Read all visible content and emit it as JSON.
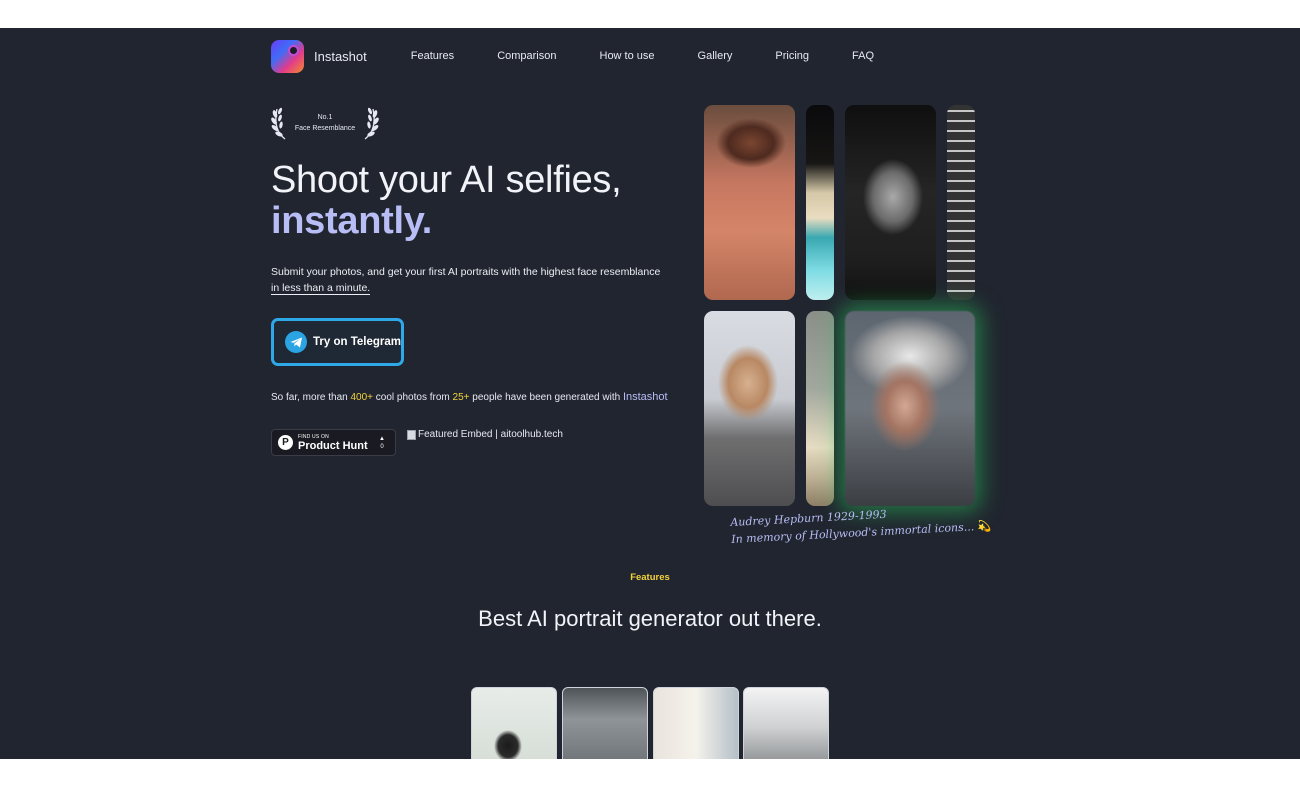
{
  "brand": {
    "name": "Instashot"
  },
  "nav": {
    "items": [
      {
        "label": "Features"
      },
      {
        "label": "Comparison"
      },
      {
        "label": "How to use"
      },
      {
        "label": "Gallery"
      },
      {
        "label": "Pricing"
      },
      {
        "label": "FAQ"
      }
    ]
  },
  "award": {
    "line1": "No.1",
    "line2": "Face Resemblance"
  },
  "hero": {
    "headline_1": "Shoot your AI selfies,",
    "headline_2": "instantly.",
    "subtitle_main": "Submit your photos, and get your first AI portraits with the highest face resemblance ",
    "subtitle_underlined": "in less than a minute.",
    "cta_label": "Try on Telegram",
    "stats_prefix": "So far, more than ",
    "stats_photos": "400+",
    "stats_mid": " cool photos from ",
    "stats_people": "25+",
    "stats_suffix": " people have been generated with ",
    "stats_brand": "Instashot"
  },
  "badges": {
    "producthunt_small": "FIND US ON",
    "producthunt_big": "Product Hunt",
    "producthunt_votes": "0",
    "embed_alt": "Featured Embed | aitoolhub.tech"
  },
  "caption": {
    "line1": "Audrey Hepburn 1929-1993",
    "line2": "In memory of Hollywood's immortal icons...",
    "emoji": "💫"
  },
  "features": {
    "tag": "Features",
    "title": "Best AI portrait generator out there."
  },
  "colors": {
    "background": "#21252f",
    "accent_lavender": "#b8bdf5",
    "accent_yellow": "#f2d23a",
    "telegram_blue": "#2fa8e8",
    "glow_green": "#26be5a"
  }
}
